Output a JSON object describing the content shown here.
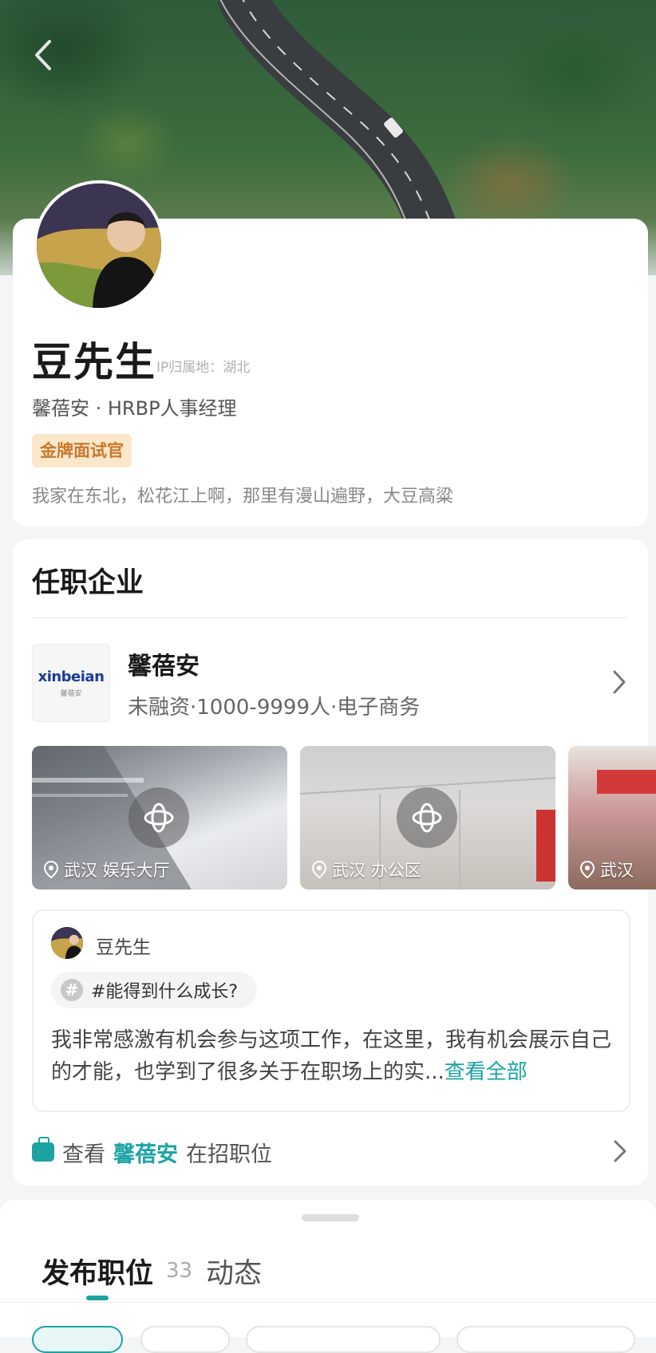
{
  "profile": {
    "name": "豆先生",
    "ip_location": "IP归属地：湖北",
    "company_title": "馨蓓安 · HRBP人事经理",
    "badge": "金牌面试官",
    "bio": "我家在东北，松花江上啊，那里有漫山遍野，大豆高粱"
  },
  "employer": {
    "section_title": "任职企业",
    "company_name": "馨蓓安",
    "company_meta": "未融资·1000-9999人·电子商务",
    "logo_text": "xinbeian",
    "logo_subtext": "馨蓓安",
    "photos": [
      {
        "location": "武汉 娱乐大厅"
      },
      {
        "location": "武汉 办公区"
      },
      {
        "location": "武汉"
      }
    ]
  },
  "qa": {
    "author": "豆先生",
    "tag": "#能得到什么成长?",
    "text": "我非常感激有机会参与这项工作，在这里，我有机会展示自己的才能，也学到了很多关于在职场上的实...",
    "more": "查看全部"
  },
  "jobs_link": {
    "prefix": "查看",
    "company": "馨蓓安",
    "suffix": "在招职位"
  },
  "tabs": {
    "jobs": "发布职位",
    "jobs_count": "33",
    "posts": "动态"
  },
  "colors": {
    "accent": "#1ba3a4",
    "badge_bg": "#fde7cb",
    "badge_text": "#c9792b"
  }
}
